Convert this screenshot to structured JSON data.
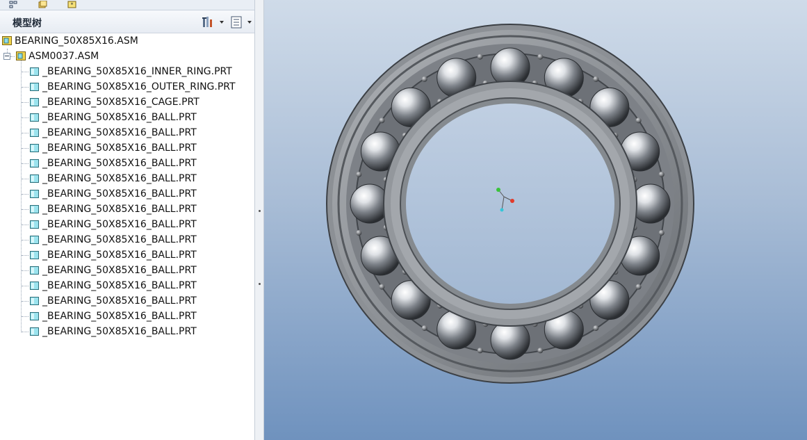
{
  "tabs": [
    {
      "icon": "model-tree-icon"
    },
    {
      "icon": "folder-browser-icon"
    },
    {
      "icon": "favorites-icon"
    }
  ],
  "tree_panel": {
    "title": "模型树",
    "settings_icon": "tree-settings-icon",
    "show_icon": "show-columns-icon"
  },
  "tree": {
    "root": {
      "label": "BEARING_50X85X16.ASM",
      "icon": "assembly-icon"
    },
    "sub": {
      "label": "ASM0037.ASM",
      "icon": "assembly-icon",
      "expanded": true
    },
    "parts": [
      "_BEARING_50X85X16_INNER_RING.PRT",
      "_BEARING_50X85X16_OUTER_RING.PRT",
      "_BEARING_50X85X16_CAGE.PRT",
      "_BEARING_50X85X16_BALL.PRT",
      "_BEARING_50X85X16_BALL.PRT",
      "_BEARING_50X85X16_BALL.PRT",
      "_BEARING_50X85X16_BALL.PRT",
      "_BEARING_50X85X16_BALL.PRT",
      "_BEARING_50X85X16_BALL.PRT",
      "_BEARING_50X85X16_BALL.PRT",
      "_BEARING_50X85X16_BALL.PRT",
      "_BEARING_50X85X16_BALL.PRT",
      "_BEARING_50X85X16_BALL.PRT",
      "_BEARING_50X85X16_BALL.PRT",
      "_BEARING_50X85X16_BALL.PRT",
      "_BEARING_50X85X16_BALL.PRT",
      "_BEARING_50X85X16_BALL.PRT",
      "_BEARING_50X85X16_BALL.PRT"
    ]
  },
  "viewport": {
    "model": "ball-bearing-3d-model",
    "ball_count": 16,
    "background_top": "#cfdbe9",
    "background_bottom": "#6f92be",
    "csys_colors": {
      "x": "#e23a2a",
      "y": "#39c43a",
      "z": "#35c6d8"
    }
  }
}
